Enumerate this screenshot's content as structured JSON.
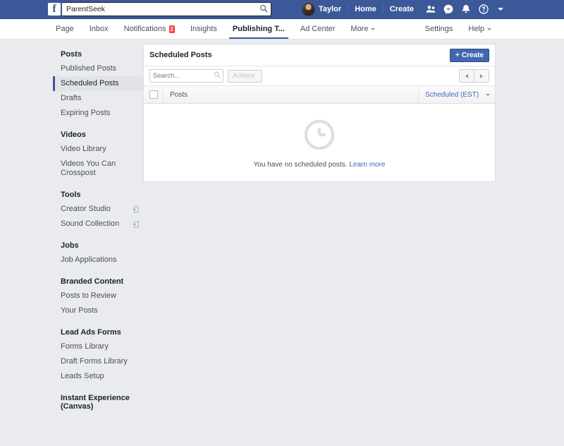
{
  "topbar": {
    "logo": "f",
    "search": {
      "value": "ParentSeek",
      "placeholder": "Search",
      "icon": "search-icon"
    },
    "user_name": "Taylor",
    "home_label": "Home",
    "create_label": "Create",
    "icons": [
      "friend-requests-icon",
      "messenger-icon",
      "notifications-bell-icon",
      "help-circle-icon",
      "account-chevron-down-icon"
    ],
    "brand_color": "#3b5998"
  },
  "tabbar": {
    "tabs": [
      {
        "label": "Page",
        "active": false,
        "badge": ""
      },
      {
        "label": "Inbox",
        "active": false,
        "badge": ""
      },
      {
        "label": "Notifications",
        "active": false,
        "badge": "2"
      },
      {
        "label": "Insights",
        "active": false,
        "badge": ""
      },
      {
        "label": "Publishing T...",
        "active": true,
        "badge": ""
      },
      {
        "label": "Ad Center",
        "active": false,
        "badge": ""
      },
      {
        "label": "More",
        "active": false,
        "badge": "",
        "caret": true
      }
    ],
    "settings_label": "Settings",
    "help_label": "Help",
    "badge_color": "#fa3e3e"
  },
  "sidebar": {
    "groups": [
      {
        "heading": "Posts",
        "items": [
          {
            "label": "Published Posts",
            "selected": false,
            "external": false
          },
          {
            "label": "Scheduled Posts",
            "selected": true,
            "external": false
          },
          {
            "label": "Drafts",
            "selected": false,
            "external": false
          },
          {
            "label": "Expiring Posts",
            "selected": false,
            "external": false
          }
        ]
      },
      {
        "heading": "Videos",
        "items": [
          {
            "label": "Video Library",
            "selected": false,
            "external": false
          },
          {
            "label": "Videos You Can Crosspost",
            "selected": false,
            "external": false
          }
        ]
      },
      {
        "heading": "Tools",
        "items": [
          {
            "label": "Creator Studio",
            "selected": false,
            "external": true
          },
          {
            "label": "Sound Collection",
            "selected": false,
            "external": true
          }
        ]
      },
      {
        "heading": "Jobs",
        "items": [
          {
            "label": "Job Applications",
            "selected": false,
            "external": false
          }
        ]
      },
      {
        "heading": "Branded Content",
        "items": [
          {
            "label": "Posts to Review",
            "selected": false,
            "external": false
          },
          {
            "label": "Your Posts",
            "selected": false,
            "external": false
          }
        ]
      },
      {
        "heading": "Lead Ads Forms",
        "items": [
          {
            "label": "Forms Library",
            "selected": false,
            "external": false
          },
          {
            "label": "Draft Forms Library",
            "selected": false,
            "external": false
          },
          {
            "label": "Leads Setup",
            "selected": false,
            "external": false
          }
        ]
      },
      {
        "heading": "Instant Experience (Canvas)",
        "items": []
      }
    ],
    "selected_accent": "#3b5998"
  },
  "main": {
    "title": "Scheduled Posts",
    "create_button": "Create",
    "create_plus": "+",
    "search_placeholder": "Search...",
    "search_value": "",
    "actions_label": "Actions",
    "pager": {
      "prev": "prev-page-icon",
      "next": "next-page-icon"
    },
    "table": {
      "columns": [
        "Posts",
        "Scheduled (EST)"
      ],
      "rows": [],
      "sort_column_color": "#4267b2"
    },
    "empty_state": {
      "icon": "clock-icon",
      "message": "You have no scheduled posts.",
      "link": "Learn more",
      "link_color": "#4267b2"
    }
  }
}
